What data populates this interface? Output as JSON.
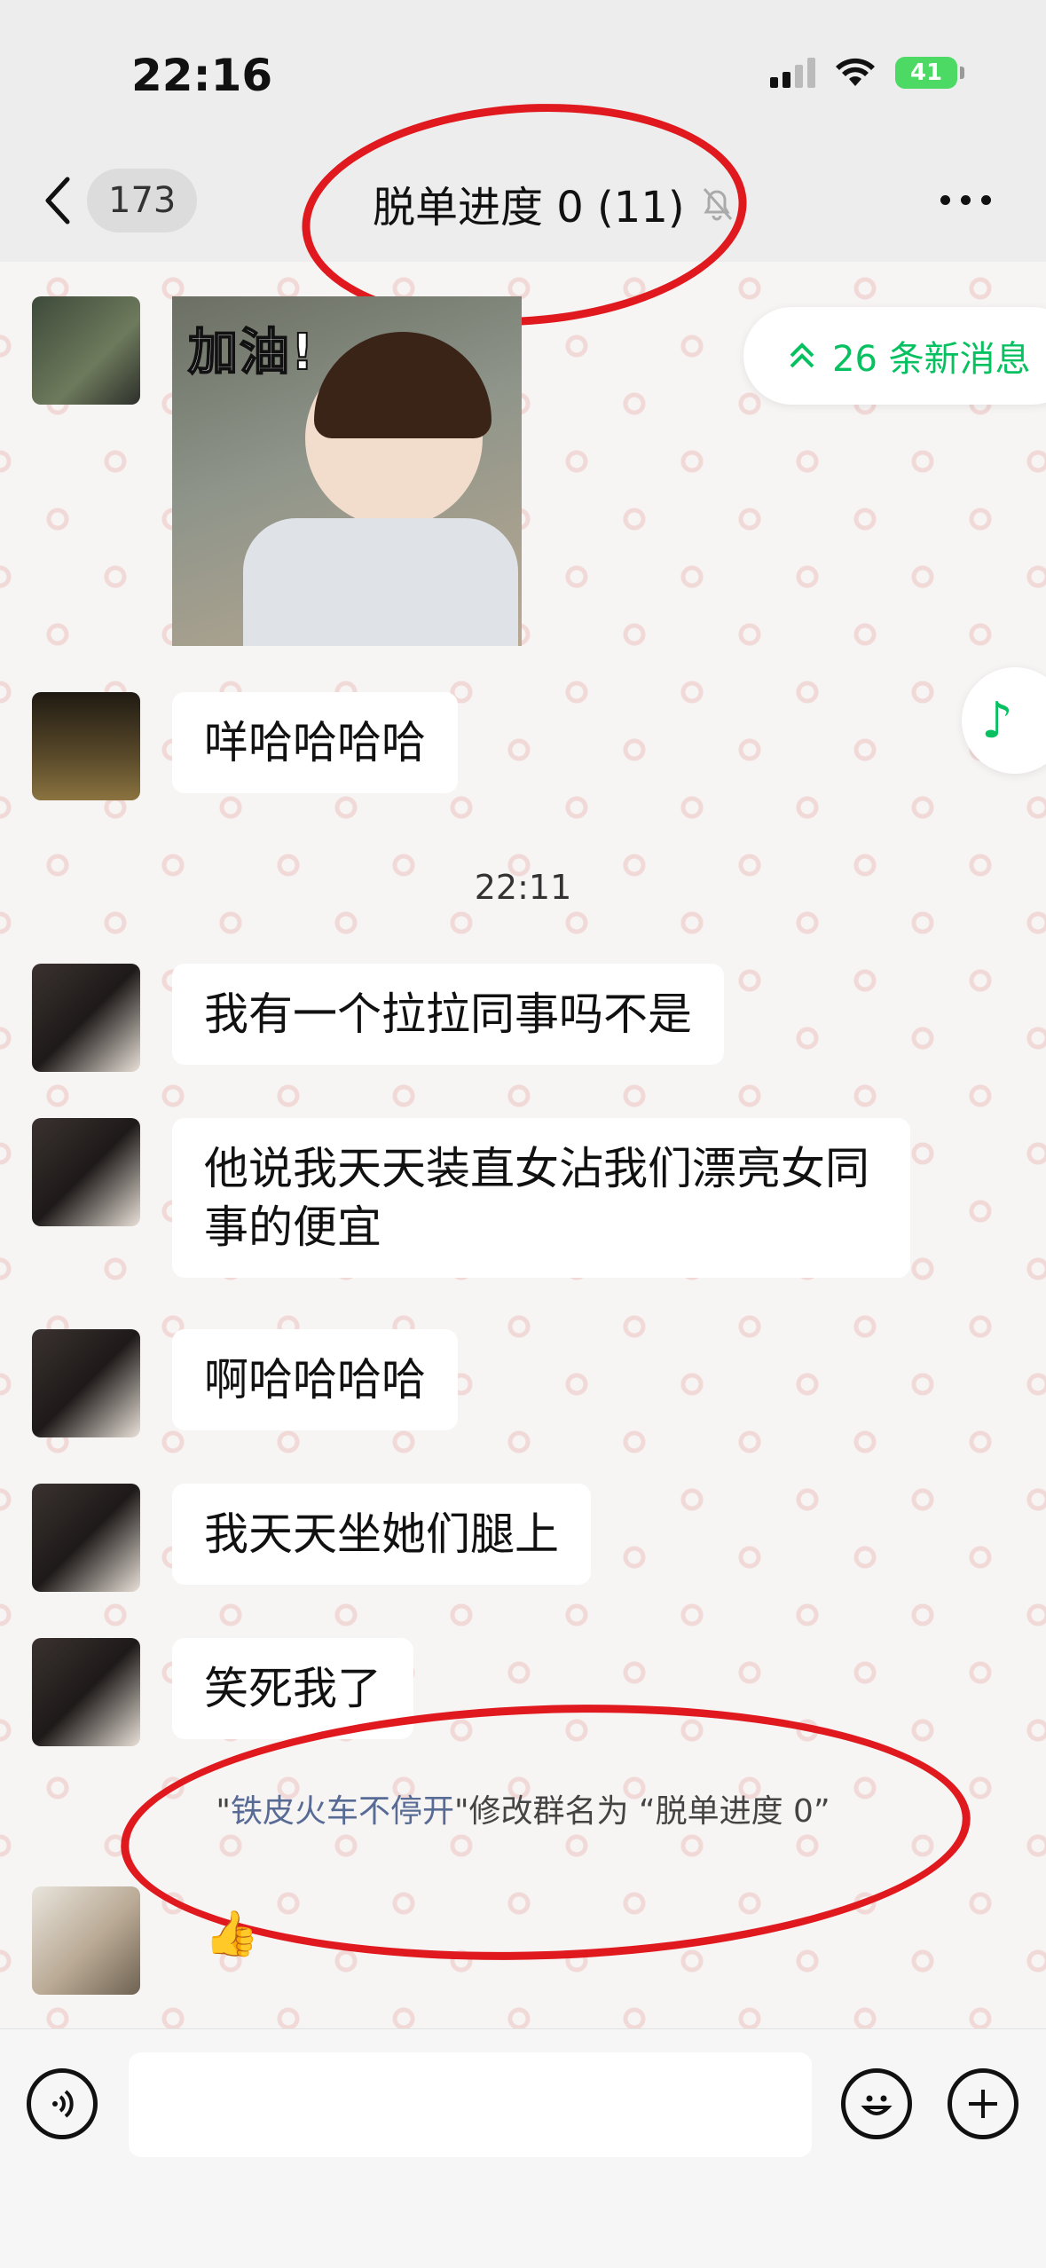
{
  "status_bar": {
    "time": "22:16",
    "battery": "41"
  },
  "nav": {
    "back_count": "173",
    "title": "脱单进度 0 (11)",
    "mute_icon": "bell-slash-icon",
    "more_icon": "more-dots-icon"
  },
  "unread_banner": {
    "icon": "double-chevron-up-icon",
    "label": "26 条新消息"
  },
  "music_icon": "music-note-icon",
  "messages": [
    {
      "type": "sticker",
      "sticker_text": "加油!"
    },
    {
      "type": "text",
      "text": "咩哈哈哈哈"
    },
    {
      "type": "time",
      "text": "22:11"
    },
    {
      "type": "text",
      "text": "我有一个拉拉同事吗不是"
    },
    {
      "type": "text",
      "text": "他说我天天装直女沾我们漂亮女同事的便宜"
    },
    {
      "type": "text",
      "text": "啊哈哈哈哈"
    },
    {
      "type": "text",
      "text": "我天天坐她们腿上"
    },
    {
      "type": "text",
      "text": "笑死我了"
    },
    {
      "type": "text",
      "text": "👍"
    }
  ],
  "system_message": {
    "quote_open": "\"",
    "user": "铁皮火车不停开",
    "action": "\"修改群名为 “脱单进度 0”"
  },
  "input_bar": {
    "voice_icon": "voice-icon",
    "emoji_icon": "emoji-icon",
    "plus_icon": "plus-icon",
    "placeholder": ""
  },
  "colors": {
    "accent_green": "#07c160",
    "link_blue": "#576b95",
    "annotation_red": "#e0191e"
  }
}
